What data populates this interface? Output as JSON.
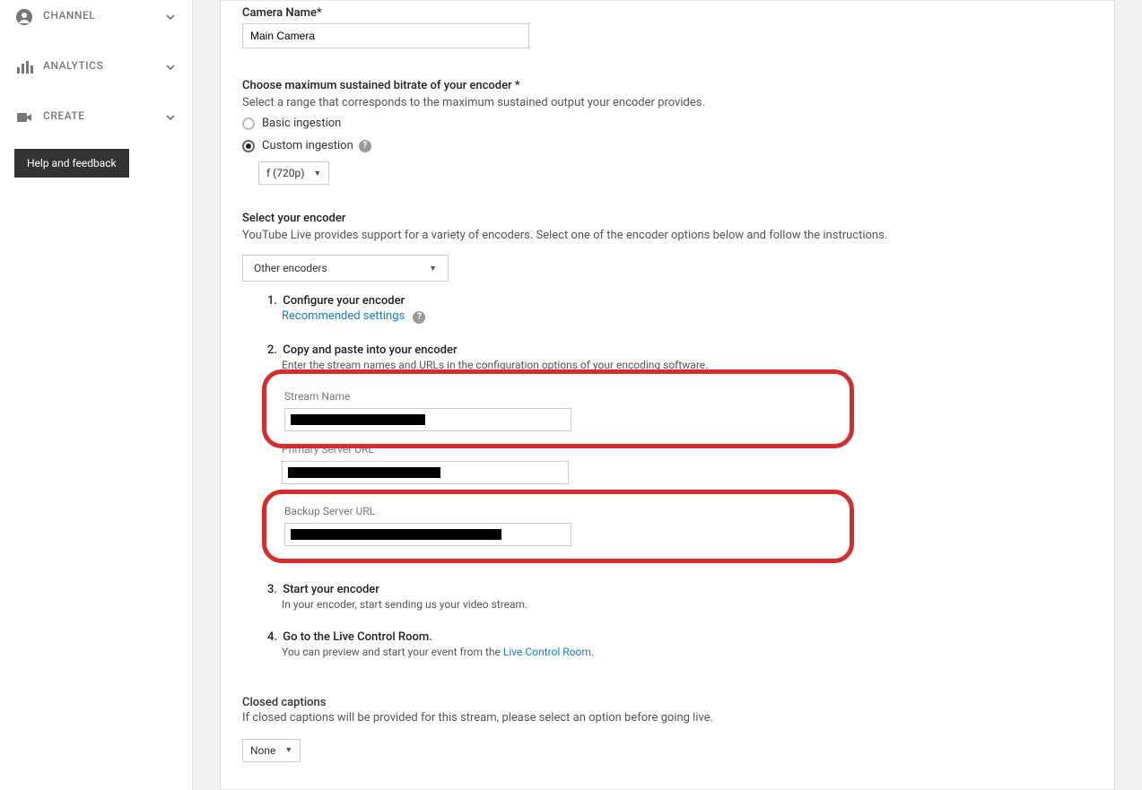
{
  "sidebar": {
    "items": [
      {
        "label": "CHANNEL"
      },
      {
        "label": "ANALYTICS"
      },
      {
        "label": "CREATE"
      }
    ],
    "help_label": "Help and feedback"
  },
  "camera": {
    "label": "Camera Name*",
    "value": "Main Camera"
  },
  "bitrate": {
    "title": "Choose maximum sustained bitrate of your encoder *",
    "subtitle": "Select a range that corresponds to the maximum sustained output your encoder provides.",
    "basic_label": "Basic ingestion",
    "custom_label": "Custom ingestion",
    "dropdown_value": "f (720p)"
  },
  "encoder": {
    "title": "Select your encoder",
    "subtitle": "YouTube Live provides support for a variety of encoders. Select one of the encoder options below and follow the instructions.",
    "dropdown_value": "Other encoders"
  },
  "steps": {
    "s1": {
      "num": "1.",
      "title": "Configure your encoder",
      "link": "Recommended settings"
    },
    "s2": {
      "num": "2.",
      "title": "Copy and paste into your encoder",
      "sub": "Enter the stream names and URLs in the configuration options of your encoding software.",
      "stream_name_label": "Stream Name",
      "primary_label": "Primary Server URL",
      "backup_label": "Backup Server URL"
    },
    "s3": {
      "num": "3.",
      "title": "Start your encoder",
      "sub": "In your encoder, start sending us your video stream."
    },
    "s4": {
      "num": "4.",
      "title": "Go to the Live Control Room.",
      "sub_prefix": "You can preview and start your event from the ",
      "link": "Live Control Room",
      "sub_suffix": "."
    }
  },
  "captions": {
    "title": "Closed captions",
    "sub": "If closed captions will be provided for this stream, please select an option before going live.",
    "dropdown_value": "None"
  }
}
